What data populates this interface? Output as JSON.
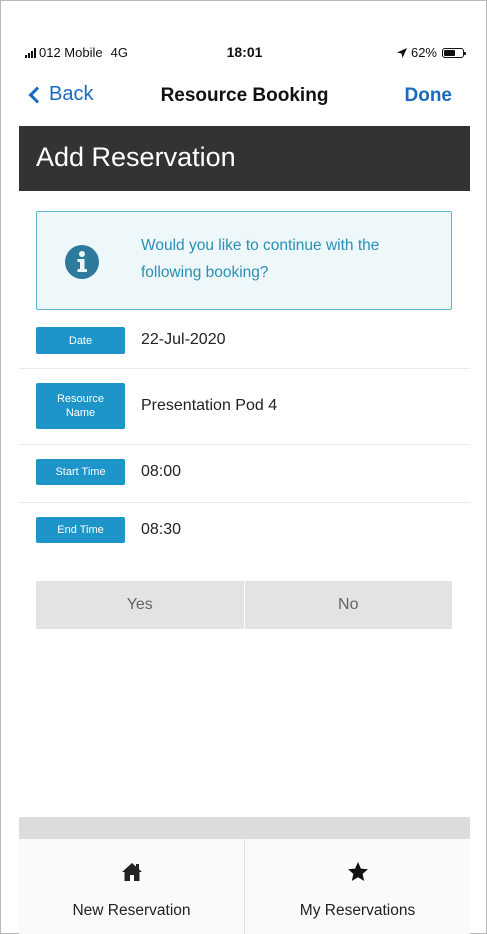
{
  "status_bar": {
    "carrier": "012 Mobile",
    "network": "4G",
    "time": "18:01",
    "battery": "62%",
    "battery_level": 0.62,
    "location_icon": "location-arrow-icon"
  },
  "nav": {
    "back_label": "Back",
    "title": "Resource Booking",
    "done_label": "Done"
  },
  "page": {
    "title": "Add Reservation"
  },
  "info": {
    "icon": "info-icon",
    "message": "Would you like to continue with the following booking?"
  },
  "details": [
    {
      "label": "Date",
      "value": "22-Jul-2020"
    },
    {
      "label": "Resource Name",
      "value": "Presentation Pod 4"
    },
    {
      "label": "Start Time",
      "value": "08:00"
    },
    {
      "label": "End Time",
      "value": "08:30"
    }
  ],
  "actions": {
    "yes_label": "Yes",
    "no_label": "No"
  },
  "tabs": [
    {
      "label": "New Reservation",
      "icon": "home-icon"
    },
    {
      "label": "My Reservations",
      "icon": "star-icon"
    }
  ],
  "colors": {
    "accent": "#1a6bbd",
    "header_bg": "#333333",
    "chip_bg": "#1d95c9",
    "info_text": "#2a8fb5",
    "info_border": "#5bb5cf"
  }
}
